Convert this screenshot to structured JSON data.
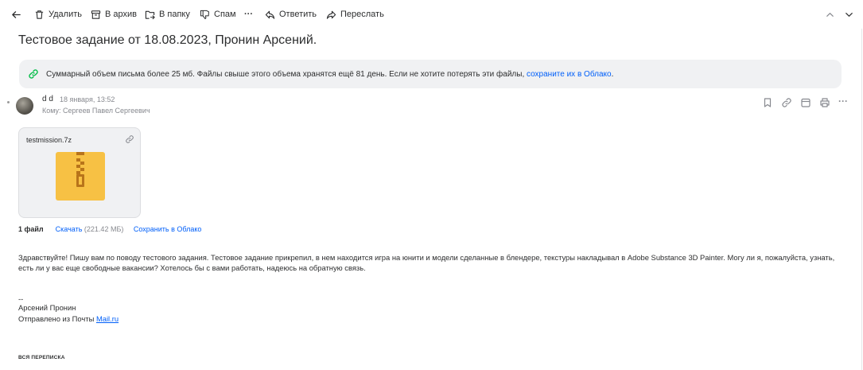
{
  "toolbar": {
    "delete_label": "Удалить",
    "archive_label": "В архив",
    "folder_label": "В папку",
    "spam_label": "Спам",
    "more_label": "···",
    "reply_label": "Ответить",
    "forward_label": "Переслать"
  },
  "message": {
    "subject": "Тестовое задание от 18.08.2023, Пронин Арсений.",
    "notice_text": "Суммарный объем письма более 25 мб. Файлы свыше этого объема хранятся ещё 81 день. Если не хотите потерять эти файлы,",
    "notice_link": "сохраните их в Облако",
    "notice_end": ".",
    "sender": "d d",
    "date": "18 января, 13:52",
    "to": "Кому: Сергеев Павел Сергеевич",
    "more_actions": "···"
  },
  "attachment": {
    "filename": "testmission.7z",
    "files_count": "1 файл",
    "download_label": "Скачать",
    "size": "(221.42 МБ)",
    "save_cloud_label": "Сохранить в Облако"
  },
  "body": {
    "text": "Здравствуйте! Пишу вам по поводу тестового задания. Тестовое задание прикрепил, в нем находится игра на юнити и модели сделанные в блендере, текстуры накладывал в Adobe Substance 3D Painter. Могу ли я, пожалуйста, узнать, есть ли у вас еще свободные вакансии? Хотелось бы с вами работать, надеюсь на обратную связь.",
    "sig_dashes": "--",
    "sig_name": "Арсений Пронин",
    "sig_sent": "Отправлено из Почты",
    "sig_link": "Mail.ru"
  },
  "thread": {
    "all_conversation": "ВСЯ ПЕРЕПИСКА"
  },
  "colors": {
    "accent": "#005ff9",
    "notice_bg": "#f0f1f3",
    "zip_yellow": "#f7c144",
    "zip_brown": "#b8741a"
  },
  "icons": [
    "back-arrow-icon",
    "trash-icon",
    "archive-icon",
    "folder-move-icon",
    "spam-icon",
    "reply-icon",
    "forward-icon",
    "chevron-up-icon",
    "chevron-down-icon",
    "link-icon",
    "bookmark-icon",
    "chain-link-icon",
    "calendar-icon",
    "print-icon",
    "more-icon",
    "zip-file-icon"
  ]
}
